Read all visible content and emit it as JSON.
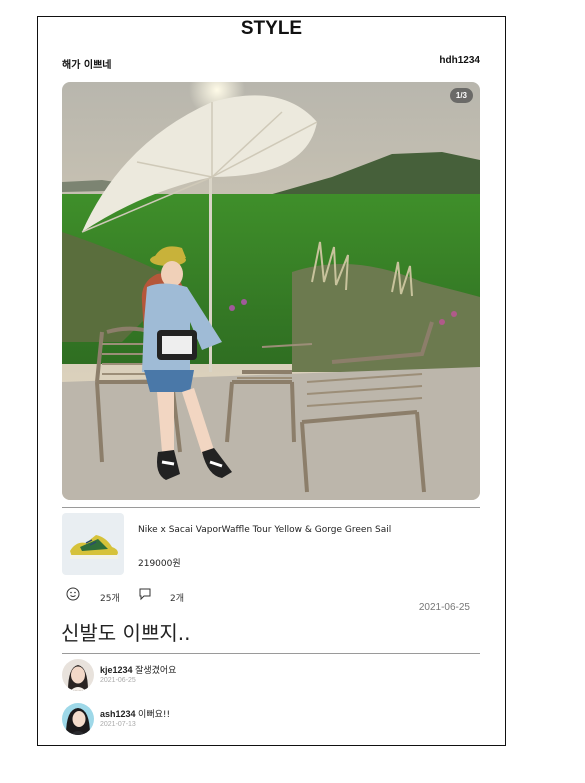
{
  "header": {
    "title": "STYLE",
    "left_label": "해가 이쁘네",
    "username": "hdh1234"
  },
  "photo": {
    "counter": "1/3",
    "description_icon": "photo-outdoor-umbrella"
  },
  "product": {
    "name": "Nike x Sacai VaporWaffle Tour Yellow & Gorge Green Sail",
    "price": "219000원",
    "icon": "sneaker-icon"
  },
  "actions": {
    "likes": "25개",
    "comments": "2개",
    "like_icon": "smile-icon",
    "comment_icon": "speech-bubble-icon",
    "date": "2021-06-25"
  },
  "caption": "신발도 이쁘지..",
  "comments": [
    {
      "user": "kje1234",
      "text": "잘생겼어요",
      "date": "2021-06-25"
    },
    {
      "user": "ash1234",
      "text": "이뻐요!!",
      "date": "2021-07-13"
    }
  ],
  "colors": {
    "border": "#111111",
    "divider": "#9a9a9a",
    "grass": "#3c8a2a",
    "sky": "#c9c2b0"
  }
}
